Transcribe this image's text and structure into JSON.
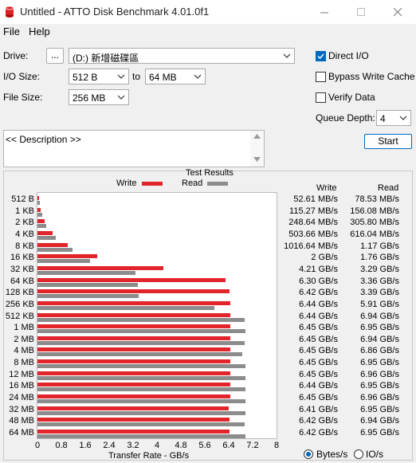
{
  "window": {
    "title": "Untitled - ATTO Disk Benchmark 4.01.0f1"
  },
  "menu": {
    "items": [
      "File",
      "Help"
    ]
  },
  "drive": {
    "label": "Drive:",
    "browse": "...",
    "value": "(D:) 新增磁碟區"
  },
  "io_size": {
    "label": "I/O Size:",
    "from": "512 B",
    "to_label": "to",
    "to": "64 MB"
  },
  "file_size": {
    "label": "File Size:",
    "value": "256 MB"
  },
  "options": {
    "direct_io": {
      "label": "Direct I/O",
      "checked": true
    },
    "bypass_write_cache": {
      "label": "Bypass Write Cache",
      "checked": false
    },
    "verify_data": {
      "label": "Verify Data",
      "checked": false
    },
    "queue_depth": {
      "label": "Queue Depth:",
      "value": "4"
    }
  },
  "start_button": "Start",
  "description": "<< Description >>",
  "results": {
    "title": "Test Results",
    "legend_write": "Write",
    "legend_read": "Read",
    "col_write": "Write",
    "col_read": "Read",
    "x_axis_label": "Transfer Rate - GB/s",
    "unit_bytes": "Bytes/s",
    "unit_io": "IO/s",
    "selected_unit": "Bytes/s"
  },
  "colors": {
    "write": "#e2252b",
    "read": "#8c8c8c",
    "accent": "#0067c0"
  },
  "chart_data": {
    "type": "bar",
    "orientation": "horizontal",
    "xlabel": "Transfer Rate - GB/s",
    "xlim": [
      0,
      8
    ],
    "xticks": [
      "0",
      "0.8",
      "1.6",
      "2.4",
      "3.2",
      "4",
      "4.8",
      "5.6",
      "6.4",
      "7.2",
      "8"
    ],
    "categories": [
      "512 B",
      "1 KB",
      "2 KB",
      "4 KB",
      "8 KB",
      "16 KB",
      "32 KB",
      "64 KB",
      "128 KB",
      "256 KB",
      "512 KB",
      "1 MB",
      "2 MB",
      "4 MB",
      "8 MB",
      "12 MB",
      "16 MB",
      "24 MB",
      "32 MB",
      "48 MB",
      "64 MB"
    ],
    "series": [
      {
        "name": "Write",
        "values": [
          0.0526,
          0.1153,
          0.2486,
          0.5037,
          1.0166,
          2.0,
          4.21,
          6.3,
          6.42,
          6.44,
          6.44,
          6.45,
          6.45,
          6.45,
          6.45,
          6.45,
          6.44,
          6.45,
          6.41,
          6.42,
          6.42
        ],
        "labels": [
          "52.61 MB/s",
          "115.27 MB/s",
          "248.64 MB/s",
          "503.66 MB/s",
          "1016.64 MB/s",
          "2 GB/s",
          "4.21 GB/s",
          "6.30 GB/s",
          "6.42 GB/s",
          "6.44 GB/s",
          "6.44 GB/s",
          "6.45 GB/s",
          "6.45 GB/s",
          "6.45 GB/s",
          "6.45 GB/s",
          "6.45 GB/s",
          "6.44 GB/s",
          "6.45 GB/s",
          "6.41 GB/s",
          "6.42 GB/s",
          "6.42 GB/s"
        ]
      },
      {
        "name": "Read",
        "values": [
          0.0785,
          0.1561,
          0.3058,
          0.616,
          1.17,
          1.76,
          3.29,
          3.36,
          3.39,
          5.91,
          6.94,
          6.95,
          6.94,
          6.86,
          6.95,
          6.96,
          6.95,
          6.96,
          6.95,
          6.94,
          6.95
        ],
        "labels": [
          "78.53 MB/s",
          "156.08 MB/s",
          "305.80 MB/s",
          "616.04 MB/s",
          "1.17 GB/s",
          "1.76 GB/s",
          "3.29 GB/s",
          "3.36 GB/s",
          "3.39 GB/s",
          "5.91 GB/s",
          "6.94 GB/s",
          "6.95 GB/s",
          "6.94 GB/s",
          "6.86 GB/s",
          "6.95 GB/s",
          "6.96 GB/s",
          "6.95 GB/s",
          "6.96 GB/s",
          "6.95 GB/s",
          "6.94 GB/s",
          "6.95 GB/s"
        ]
      }
    ]
  }
}
